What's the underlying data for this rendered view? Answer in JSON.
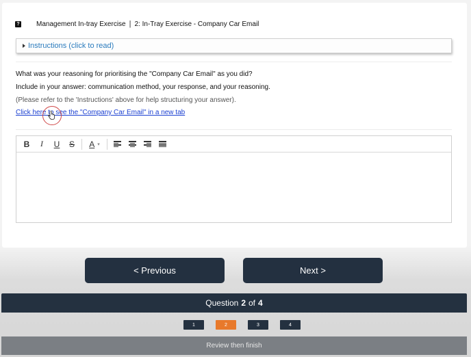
{
  "header": {
    "help_icon": "?",
    "course": "Management In-tray Exercise",
    "separator": "|",
    "exercise": "2: In-Tray Exercise - Company Car Email"
  },
  "instructions": {
    "label": "Instructions (click to read)",
    "icon": "triangle-right-icon"
  },
  "question": {
    "line1": "What was your reasoning for prioritising the \"Company Car Email\" as you did?",
    "line2": "Include in your answer: communication method, your response, and your reasoning.",
    "note": "(Please refer to the 'Instructions' above for help structuring your answer).",
    "link": "Click here to see the \"Company Car Email\" in a new tab"
  },
  "editor": {
    "bold": "B",
    "italic": "I",
    "underline": "U",
    "strike": "S",
    "font_color": "A",
    "color_caret": "▾",
    "content": ""
  },
  "nav": {
    "previous": "< Previous",
    "next": "Next >"
  },
  "progress": {
    "prefix": "Question",
    "current": "2",
    "of": "of",
    "total": "4"
  },
  "pages": [
    "1",
    "2",
    "3",
    "4"
  ],
  "active_page": "2",
  "review_label": "Review then finish",
  "colors": {
    "dark": "#243140",
    "accent": "#e8792b",
    "link": "#1a3fd1",
    "review": "#7b7f84"
  }
}
